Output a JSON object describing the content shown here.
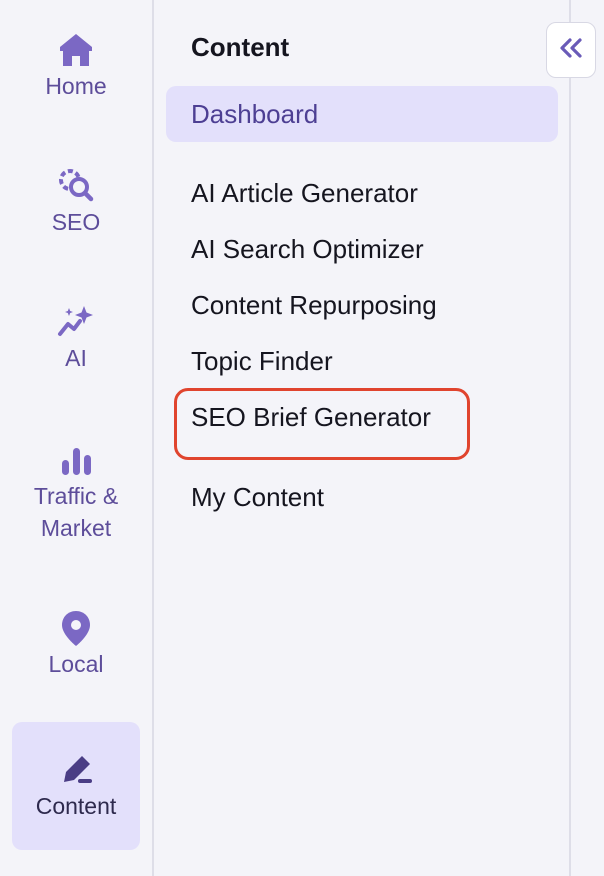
{
  "rail": {
    "items": [
      {
        "label": "Home",
        "icon": "home-icon"
      },
      {
        "label": "SEO",
        "icon": "seo-icon"
      },
      {
        "label": "AI",
        "icon": "ai-sparkle-icon"
      },
      {
        "label": "Traffic &\nMarket",
        "icon": "bar-chart-icon"
      },
      {
        "label": "Local",
        "icon": "location-pin-icon"
      },
      {
        "label": "Content",
        "icon": "pen-icon",
        "active": true
      }
    ]
  },
  "panel": {
    "title": "Content",
    "items": [
      {
        "label": "Dashboard",
        "selected": true
      },
      {
        "label": "AI Article Generator"
      },
      {
        "label": "AI Search Optimizer"
      },
      {
        "label": "Content Repurposing"
      },
      {
        "label": "Topic Finder"
      },
      {
        "label": "SEO Brief Generator",
        "highlighted": true
      },
      {
        "label": "My Content"
      }
    ]
  },
  "collapse_button": {
    "icon": "double-chevron-left-icon"
  },
  "colors": {
    "accent": "#5d4d9a",
    "active_bg": "#e3e0fb",
    "highlight": "#e0442e",
    "background": "#f4f4f9"
  }
}
